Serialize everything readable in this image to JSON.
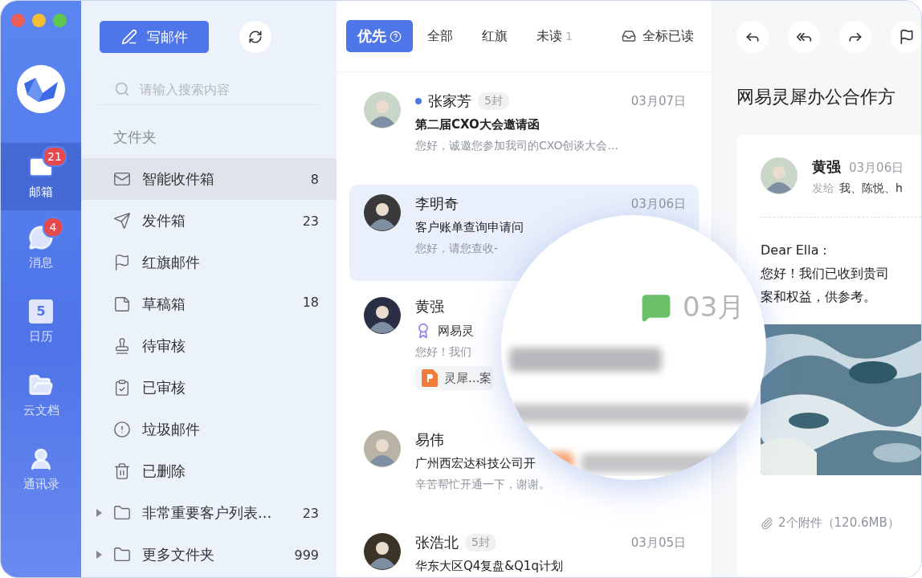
{
  "rail": {
    "items": [
      {
        "label": "邮箱",
        "badge": "21",
        "selected": true
      },
      {
        "label": "消息",
        "badge": "4",
        "selected": false
      },
      {
        "label": "日历",
        "icon_text": "5",
        "selected": false
      },
      {
        "label": "云文档",
        "selected": false
      },
      {
        "label": "通讯录",
        "selected": false
      }
    ]
  },
  "folders": {
    "compose": "写邮件",
    "search": {
      "placeholder": "请输入搜索内容"
    },
    "heading": "文件夹",
    "items": [
      {
        "label": "智能收件箱",
        "count": "8",
        "selected": true,
        "kind": "system"
      },
      {
        "label": "发件箱",
        "count": "23",
        "selected": false,
        "kind": "system"
      },
      {
        "label": "红旗邮件",
        "selected": false,
        "kind": "system"
      },
      {
        "label": "草稿箱",
        "count": "18",
        "selected": false,
        "kind": "system"
      },
      {
        "label": "待审核",
        "selected": false,
        "kind": "system"
      },
      {
        "label": "已审核",
        "selected": false,
        "kind": "system"
      },
      {
        "label": "垃圾邮件",
        "selected": false,
        "kind": "system"
      },
      {
        "label": "已删除",
        "selected": false,
        "kind": "system"
      },
      {
        "label": "非常重要客户列表...",
        "count": "23",
        "selected": false,
        "kind": "custom",
        "expanded": false
      },
      {
        "label": "更多文件夹",
        "count": "999",
        "selected": false,
        "kind": "custom",
        "expanded": false
      }
    ]
  },
  "mail_list": {
    "tabs": [
      {
        "label": "优先",
        "selected": true
      },
      {
        "label": "全部",
        "selected": false
      },
      {
        "label": "红旗",
        "selected": false
      },
      {
        "label": "未读",
        "count": "1",
        "selected": false
      }
    ],
    "mark_all_read": "全标已读",
    "items": [
      {
        "name": "张家芳",
        "unread": true,
        "thread_count": "5封",
        "date": "03月07日",
        "subject": "第二届CXO大会邀请函",
        "preview": "您好，诚邀您参加我司的CXO创谈大会...",
        "selected": false
      },
      {
        "name": "李明奇",
        "unread": false,
        "date": "03月06日",
        "subject": "客户账单查询申请问",
        "preview": "您好，请您查收-",
        "selected": true
      },
      {
        "name": "黄强",
        "unread": false,
        "tag": "网易灵",
        "preview": "您好！我们",
        "attachment": "灵犀...案",
        "selected": false
      },
      {
        "name": "易伟",
        "unread": false,
        "subject": "广州西宏达科技公司开",
        "preview": "辛苦帮忙开通一下，谢谢。",
        "selected": false
      },
      {
        "name": "张浩北",
        "unread": false,
        "thread_count": "5封",
        "date": "03月05日",
        "subject": "华东大区Q4复盘&Q1q计划",
        "selected": false
      }
    ]
  },
  "magnifier": {
    "date": "03月"
  },
  "reader": {
    "title": "网易灵犀办公合作方",
    "sender": "黄强",
    "date": "03月06日",
    "to_label": "发给",
    "to": "我、陈悦、h",
    "greeting": "Dear Ella：",
    "body": [
      "您好！我们已收到贵司",
      "案和权益，供参考。"
    ],
    "attachments": "2个附件（120.6MB）"
  }
}
